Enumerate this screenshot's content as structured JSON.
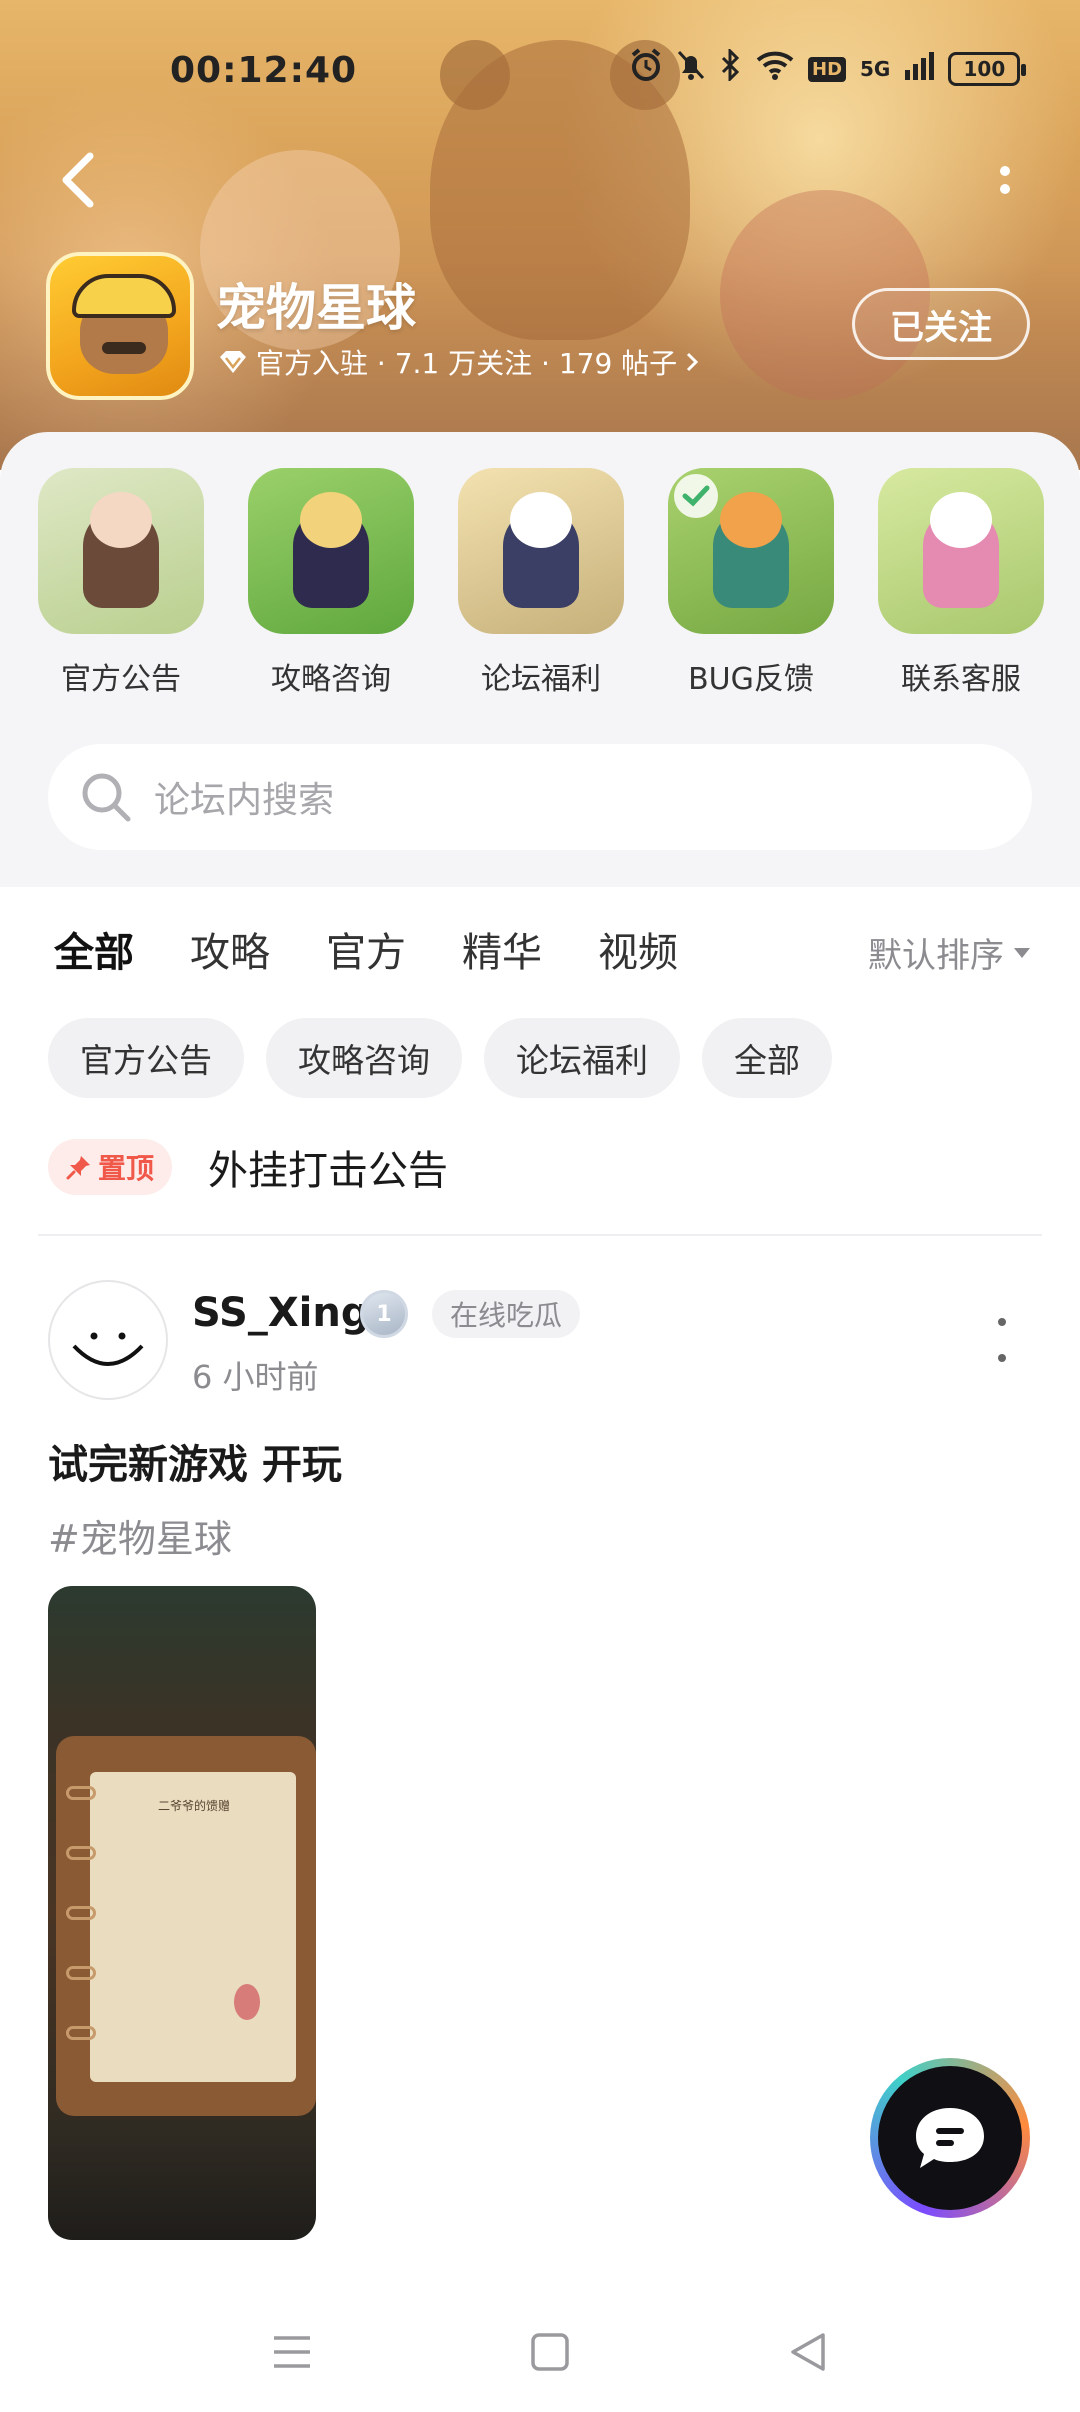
{
  "status_bar": {
    "time": "00:12:40",
    "network": "5G",
    "hd": "HD",
    "battery": "100"
  },
  "header": {
    "back_icon": "chevron-left-icon",
    "more_icon": "more-vertical-icon"
  },
  "forum": {
    "name": "宠物星球",
    "meta": "官方入驻 · 7.1 万关注 · 179 帖子",
    "verified_icon": "diamond-icon",
    "follow_label": "已关注"
  },
  "quick_links": [
    {
      "label": "官方公告"
    },
    {
      "label": "攻略咨询"
    },
    {
      "label": "论坛福利"
    },
    {
      "label": "BUG反馈"
    },
    {
      "label": "联系客服"
    }
  ],
  "search": {
    "placeholder": "论坛内搜索"
  },
  "tabs": [
    {
      "label": "全部",
      "active": true
    },
    {
      "label": "攻略"
    },
    {
      "label": "官方"
    },
    {
      "label": "精华"
    },
    {
      "label": "视频"
    }
  ],
  "sort": {
    "label": "默认排序"
  },
  "filter_chips": [
    {
      "label": "官方公告"
    },
    {
      "label": "攻略咨询"
    },
    {
      "label": "论坛福利"
    },
    {
      "label": "全部"
    }
  ],
  "pinned": {
    "badge": "置顶",
    "title": "外挂打击公告"
  },
  "post": {
    "author": "SS_Xing",
    "level": "1",
    "author_tag": "在线吃瓜",
    "time": "6 小时前",
    "title": "试完新游戏 开玩",
    "topic": "#宠物星球",
    "image_note": "二爷爷的馈赠"
  },
  "colors": {
    "accent": "#2ed3b3",
    "pin": "#f0584a",
    "banner": "#d9a25a"
  }
}
